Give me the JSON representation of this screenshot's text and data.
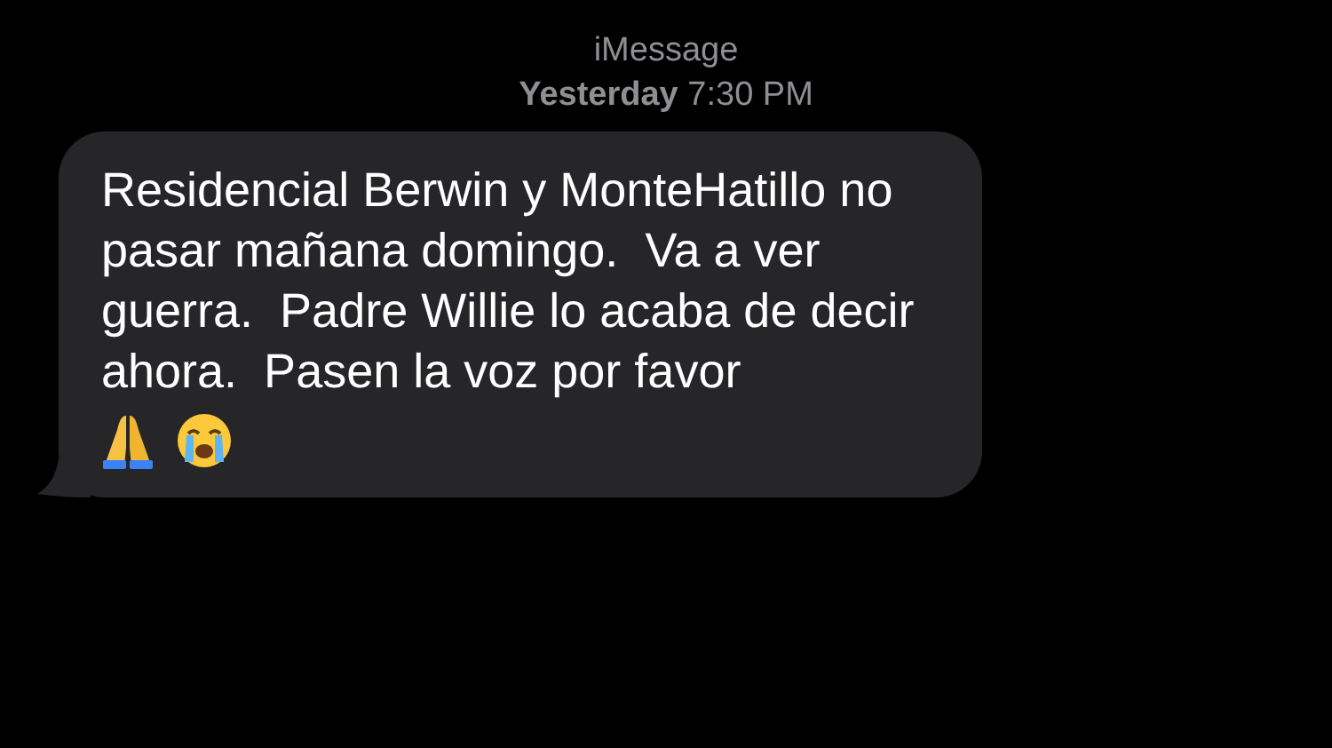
{
  "header": {
    "service": "iMessage",
    "timestamp": "**Yesterday** 7:30 PM"
  },
  "messages": [
    {
      "kind": "received",
      "text": "Residencial Berwin y MonteHatillo no pasar mañana domingo.  Va a ver guerra.  Padre Willie lo acaba de decir ahora.  Pasen la voz por favor"
    }
  ]
}
